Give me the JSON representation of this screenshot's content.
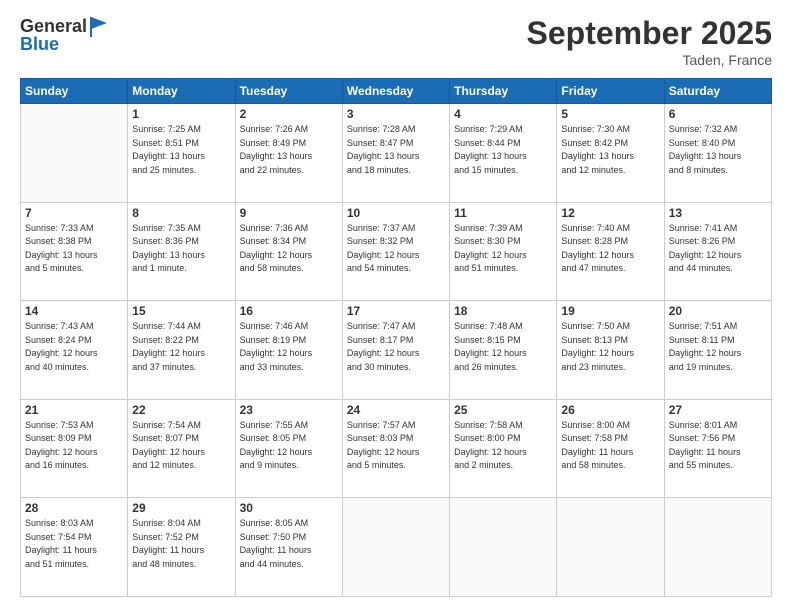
{
  "header": {
    "logo_line1": "General",
    "logo_line2": "Blue",
    "month": "September 2025",
    "location": "Taden, France"
  },
  "days_of_week": [
    "Sunday",
    "Monday",
    "Tuesday",
    "Wednesday",
    "Thursday",
    "Friday",
    "Saturday"
  ],
  "weeks": [
    [
      {
        "day": "",
        "info": ""
      },
      {
        "day": "1",
        "info": "Sunrise: 7:25 AM\nSunset: 8:51 PM\nDaylight: 13 hours\nand 25 minutes."
      },
      {
        "day": "2",
        "info": "Sunrise: 7:26 AM\nSunset: 8:49 PM\nDaylight: 13 hours\nand 22 minutes."
      },
      {
        "day": "3",
        "info": "Sunrise: 7:28 AM\nSunset: 8:47 PM\nDaylight: 13 hours\nand 18 minutes."
      },
      {
        "day": "4",
        "info": "Sunrise: 7:29 AM\nSunset: 8:44 PM\nDaylight: 13 hours\nand 15 minutes."
      },
      {
        "day": "5",
        "info": "Sunrise: 7:30 AM\nSunset: 8:42 PM\nDaylight: 13 hours\nand 12 minutes."
      },
      {
        "day": "6",
        "info": "Sunrise: 7:32 AM\nSunset: 8:40 PM\nDaylight: 13 hours\nand 8 minutes."
      }
    ],
    [
      {
        "day": "7",
        "info": "Sunrise: 7:33 AM\nSunset: 8:38 PM\nDaylight: 13 hours\nand 5 minutes."
      },
      {
        "day": "8",
        "info": "Sunrise: 7:35 AM\nSunset: 8:36 PM\nDaylight: 13 hours\nand 1 minute."
      },
      {
        "day": "9",
        "info": "Sunrise: 7:36 AM\nSunset: 8:34 PM\nDaylight: 12 hours\nand 58 minutes."
      },
      {
        "day": "10",
        "info": "Sunrise: 7:37 AM\nSunset: 8:32 PM\nDaylight: 12 hours\nand 54 minutes."
      },
      {
        "day": "11",
        "info": "Sunrise: 7:39 AM\nSunset: 8:30 PM\nDaylight: 12 hours\nand 51 minutes."
      },
      {
        "day": "12",
        "info": "Sunrise: 7:40 AM\nSunset: 8:28 PM\nDaylight: 12 hours\nand 47 minutes."
      },
      {
        "day": "13",
        "info": "Sunrise: 7:41 AM\nSunset: 8:26 PM\nDaylight: 12 hours\nand 44 minutes."
      }
    ],
    [
      {
        "day": "14",
        "info": "Sunrise: 7:43 AM\nSunset: 8:24 PM\nDaylight: 12 hours\nand 40 minutes."
      },
      {
        "day": "15",
        "info": "Sunrise: 7:44 AM\nSunset: 8:22 PM\nDaylight: 12 hours\nand 37 minutes."
      },
      {
        "day": "16",
        "info": "Sunrise: 7:46 AM\nSunset: 8:19 PM\nDaylight: 12 hours\nand 33 minutes."
      },
      {
        "day": "17",
        "info": "Sunrise: 7:47 AM\nSunset: 8:17 PM\nDaylight: 12 hours\nand 30 minutes."
      },
      {
        "day": "18",
        "info": "Sunrise: 7:48 AM\nSunset: 8:15 PM\nDaylight: 12 hours\nand 26 minutes."
      },
      {
        "day": "19",
        "info": "Sunrise: 7:50 AM\nSunset: 8:13 PM\nDaylight: 12 hours\nand 23 minutes."
      },
      {
        "day": "20",
        "info": "Sunrise: 7:51 AM\nSunset: 8:11 PM\nDaylight: 12 hours\nand 19 minutes."
      }
    ],
    [
      {
        "day": "21",
        "info": "Sunrise: 7:53 AM\nSunset: 8:09 PM\nDaylight: 12 hours\nand 16 minutes."
      },
      {
        "day": "22",
        "info": "Sunrise: 7:54 AM\nSunset: 8:07 PM\nDaylight: 12 hours\nand 12 minutes."
      },
      {
        "day": "23",
        "info": "Sunrise: 7:55 AM\nSunset: 8:05 PM\nDaylight: 12 hours\nand 9 minutes."
      },
      {
        "day": "24",
        "info": "Sunrise: 7:57 AM\nSunset: 8:03 PM\nDaylight: 12 hours\nand 5 minutes."
      },
      {
        "day": "25",
        "info": "Sunrise: 7:58 AM\nSunset: 8:00 PM\nDaylight: 12 hours\nand 2 minutes."
      },
      {
        "day": "26",
        "info": "Sunrise: 8:00 AM\nSunset: 7:58 PM\nDaylight: 11 hours\nand 58 minutes."
      },
      {
        "day": "27",
        "info": "Sunrise: 8:01 AM\nSunset: 7:56 PM\nDaylight: 11 hours\nand 55 minutes."
      }
    ],
    [
      {
        "day": "28",
        "info": "Sunrise: 8:03 AM\nSunset: 7:54 PM\nDaylight: 11 hours\nand 51 minutes."
      },
      {
        "day": "29",
        "info": "Sunrise: 8:04 AM\nSunset: 7:52 PM\nDaylight: 11 hours\nand 48 minutes."
      },
      {
        "day": "30",
        "info": "Sunrise: 8:05 AM\nSunset: 7:50 PM\nDaylight: 11 hours\nand 44 minutes."
      },
      {
        "day": "",
        "info": ""
      },
      {
        "day": "",
        "info": ""
      },
      {
        "day": "",
        "info": ""
      },
      {
        "day": "",
        "info": ""
      }
    ]
  ]
}
